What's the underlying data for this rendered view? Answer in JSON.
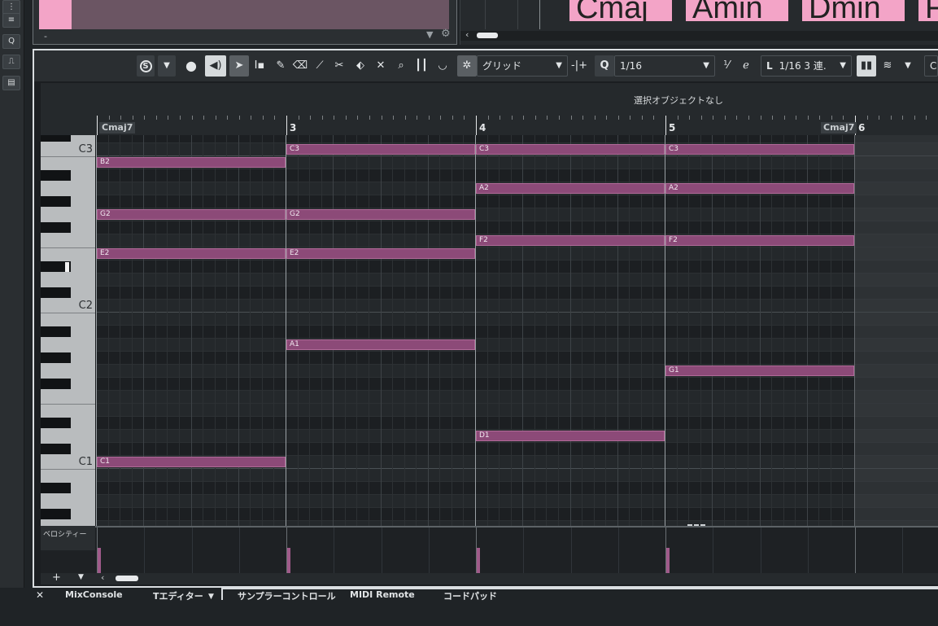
{
  "left_strip": {
    "buttons": [
      "⋮",
      "≡",
      "Q",
      "⎍",
      "▤"
    ]
  },
  "top_panel": {
    "dash": "-"
  },
  "chord_track": {
    "blocks": [
      "Cmaj",
      "Amin",
      "Dmin",
      "F"
    ]
  },
  "toolbar": {
    "solo": "S",
    "quantize_mode_label": "グリッド",
    "quantize_q": "Q",
    "quantize_value": "1/16",
    "length_label": "L",
    "length_value": "1/16 3 連.",
    "clipped_label": "C"
  },
  "info_line": {
    "text": "選択オブジェクトなし"
  },
  "ruler": {
    "bars": [
      "3",
      "4",
      "5",
      "6"
    ],
    "chord_tags": [
      "Cmaj7",
      "Cmaj7"
    ]
  },
  "keyboard": {
    "labels": [
      "C3",
      "C2",
      "C1"
    ]
  },
  "notes": [
    {
      "pitch": "C3",
      "bar_start": 3,
      "bar_end": 4
    },
    {
      "pitch": "C3",
      "bar_start": 4,
      "bar_end": 5
    },
    {
      "pitch": "C3",
      "bar_start": 5,
      "bar_end": 6
    },
    {
      "pitch": "B2",
      "bar_start": 2,
      "bar_end": 3
    },
    {
      "pitch": "A2",
      "bar_start": 4,
      "bar_end": 5
    },
    {
      "pitch": "A2",
      "bar_start": 5,
      "bar_end": 6
    },
    {
      "pitch": "G2",
      "bar_start": 2,
      "bar_end": 3
    },
    {
      "pitch": "G2",
      "bar_start": 3,
      "bar_end": 4
    },
    {
      "pitch": "F2",
      "bar_start": 4,
      "bar_end": 5
    },
    {
      "pitch": "F2",
      "bar_start": 5,
      "bar_end": 6
    },
    {
      "pitch": "E2",
      "bar_start": 2,
      "bar_end": 3
    },
    {
      "pitch": "E2",
      "bar_start": 3,
      "bar_end": 4
    },
    {
      "pitch": "A1",
      "bar_start": 3,
      "bar_end": 4
    },
    {
      "pitch": "G1",
      "bar_start": 5,
      "bar_end": 6
    },
    {
      "pitch": "D1",
      "bar_start": 4,
      "bar_end": 5
    },
    {
      "pitch": "C1",
      "bar_start": 2,
      "bar_end": 3
    }
  ],
  "velocity_lane": {
    "label": "ベロシティー"
  },
  "bottom_tabs": [
    "MixConsole",
    "Tエディター",
    "サンプラーコントロール",
    "MIDI Remote",
    "コードパッド"
  ],
  "colors": {
    "accent_pink": "#f3a4c7",
    "note_fill": "#8c4a78"
  }
}
